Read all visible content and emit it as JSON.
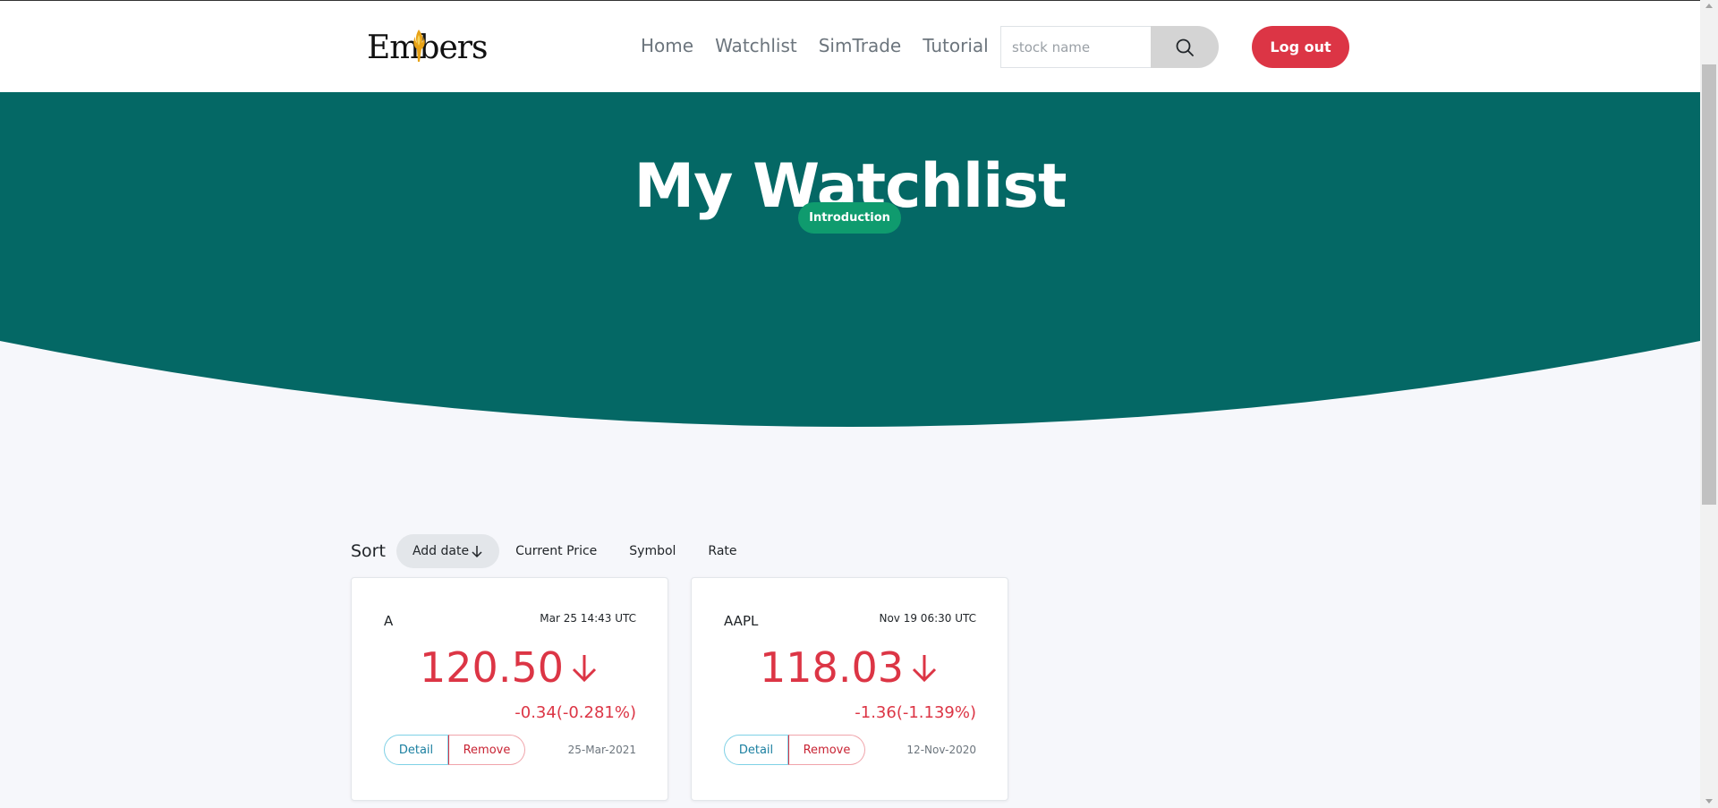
{
  "nav": {
    "logo_text": "Embers",
    "links": [
      {
        "label": "Home"
      },
      {
        "label": "Watchlist"
      },
      {
        "label": "SimTrade"
      },
      {
        "label": "Tutorial"
      }
    ],
    "search": {
      "placeholder": "stock name",
      "icon": "search-icon"
    },
    "logout_label": "Log out"
  },
  "hero": {
    "title": "My Watchlist",
    "intro_label": "Introduction"
  },
  "sort": {
    "label": "Sort",
    "options": [
      {
        "label": "Add date",
        "active": true,
        "icon": "arrow-down-icon"
      },
      {
        "label": "Current Price"
      },
      {
        "label": "Symbol"
      },
      {
        "label": "Rate"
      }
    ]
  },
  "cards": [
    {
      "symbol": "A",
      "time": "Mar 25 14:43 UTC",
      "price": "120.50",
      "change": "-0.34(-0.281%)",
      "detail_label": "Detail",
      "remove_label": "Remove",
      "date": "25-Mar-2021",
      "trend_icon": "arrow-down-icon"
    },
    {
      "symbol": "AAPL",
      "time": "Nov 19 06:30 UTC",
      "price": "118.03",
      "change": "-1.36(-1.139%)",
      "detail_label": "Detail",
      "remove_label": "Remove",
      "date": "12-Nov-2020",
      "trend_icon": "arrow-down-icon"
    }
  ],
  "colors": {
    "hero": "#046865",
    "danger": "#dc3545",
    "intro": "#0f9b6e",
    "background": "#f6f7fb"
  }
}
